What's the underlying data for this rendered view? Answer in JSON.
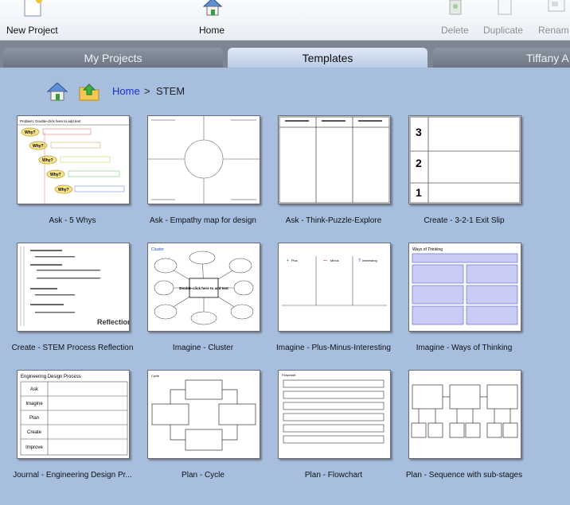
{
  "toolbar": {
    "new_project": "New Project",
    "home": "Home",
    "delete": "Delete",
    "duplicate": "Duplicate",
    "rename": "Renam"
  },
  "tabs": {
    "my_projects": "My Projects",
    "templates": "Templates",
    "user": "Tiffany A"
  },
  "breadcrumb": {
    "home": "Home",
    "separator": ">",
    "current": "STEM"
  },
  "templates": [
    {
      "label": "Ask - 5 Whys",
      "title": "Problem: Double-click here to add text",
      "items": [
        "Why?",
        "Why?",
        "Why?",
        "Why?",
        "Why?"
      ]
    },
    {
      "label": "Ask - Empathy map for design"
    },
    {
      "label": "Ask - Think-Puzzle-Explore"
    },
    {
      "label": "Create - 3-2-1 Exit Slip",
      "numbers": [
        "3",
        "2",
        "1"
      ]
    },
    {
      "label": "Create - STEM Process Reflection",
      "brand": "Reflection"
    },
    {
      "label": "Imagine - Cluster",
      "title": "Cluster",
      "center": "Double-click here to add text"
    },
    {
      "label": "Imagine - Plus-Minus-Interesting",
      "columns": [
        "Plus",
        "Minus",
        "Interesting"
      ]
    },
    {
      "label": "Imagine - Ways of Thinking",
      "title": "Ways of Thinking"
    },
    {
      "label": "Journal - Engineering Design Pr...",
      "title": "Engineering Design Process",
      "steps": [
        "Ask",
        "Imagine",
        "Plan",
        "Create",
        "Improve"
      ]
    },
    {
      "label": "Plan - Cycle",
      "title": "Cycle"
    },
    {
      "label": "Plan - Flowchart",
      "title": "Flowchart"
    },
    {
      "label": "Plan - Sequence with sub-stages"
    }
  ],
  "colors": {
    "background": "#a7bedf",
    "tab_bar": "#7d8793",
    "link": "#1733c7"
  }
}
